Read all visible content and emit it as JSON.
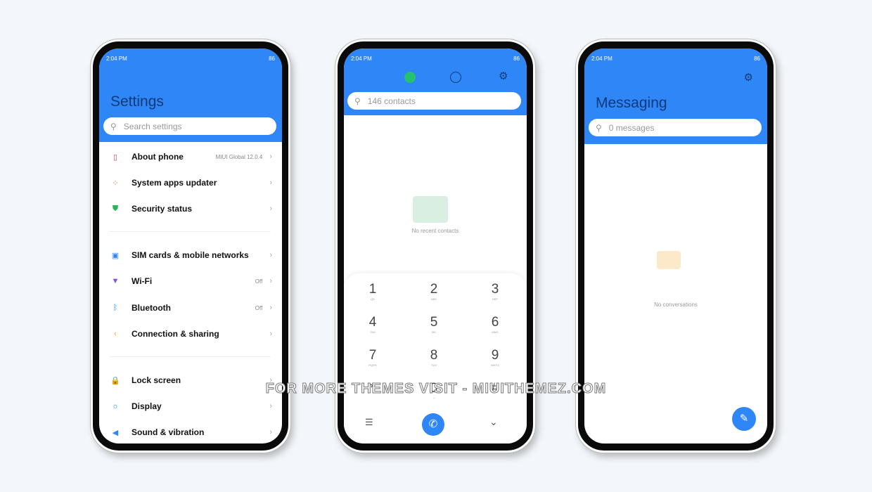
{
  "status_time": "2:04 PM",
  "status_battery": "86",
  "settings": {
    "title": "Settings",
    "search_placeholder": "Search settings",
    "items": [
      {
        "label": "About phone",
        "value": "MIUI Global 12.0.4",
        "icon": "phone-icon"
      },
      {
        "label": "System apps updater",
        "value": "",
        "icon": "apps-icon"
      },
      {
        "label": "Security status",
        "value": "",
        "icon": "shield-icon"
      },
      {
        "label": "SIM cards & mobile networks",
        "value": "",
        "icon": "sim-icon"
      },
      {
        "label": "Wi-Fi",
        "value": "Off",
        "icon": "wifi-icon"
      },
      {
        "label": "Bluetooth",
        "value": "Off",
        "icon": "bluetooth-icon"
      },
      {
        "label": "Connection & sharing",
        "value": "",
        "icon": "share-icon"
      },
      {
        "label": "Lock screen",
        "value": "",
        "icon": "lock-icon"
      },
      {
        "label": "Display",
        "value": "",
        "icon": "display-icon"
      },
      {
        "label": "Sound & vibration",
        "value": "",
        "icon": "sound-icon"
      }
    ]
  },
  "dialer": {
    "search_placeholder": "146 contacts",
    "empty_text": "No recent contacts",
    "keys": [
      {
        "d": "1",
        "l": "QD"
      },
      {
        "d": "2",
        "l": "ABC"
      },
      {
        "d": "3",
        "l": "DEF"
      },
      {
        "d": "4",
        "l": "GHI"
      },
      {
        "d": "5",
        "l": "JKL"
      },
      {
        "d": "6",
        "l": "MNO"
      },
      {
        "d": "7",
        "l": "PQRS"
      },
      {
        "d": "8",
        "l": "TUV"
      },
      {
        "d": "9",
        "l": "WXYZ"
      },
      {
        "d": "*",
        "l": ""
      },
      {
        "d": "0",
        "l": "+"
      },
      {
        "d": "#",
        "l": ""
      }
    ]
  },
  "messaging": {
    "title": "Messaging",
    "search_placeholder": "0 messages",
    "empty_text": "No conversations"
  },
  "watermark": "FOR MORE THEMES VISIT - MIUITHEMEZ.COM",
  "colors": {
    "accent": "#2f86f6",
    "background": "#f3f6fa"
  }
}
